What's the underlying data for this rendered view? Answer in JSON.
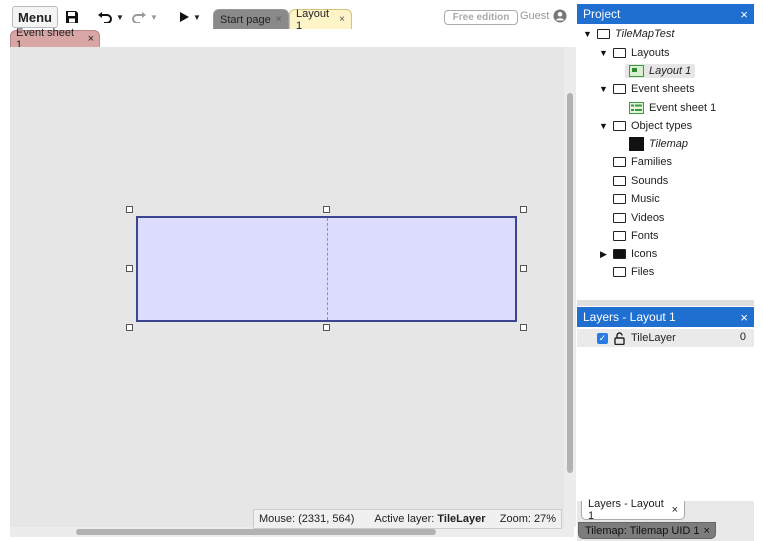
{
  "toolbar": {
    "menu_label": "Menu",
    "tabs": [
      {
        "label": "Start page",
        "close": "×"
      },
      {
        "label": "Layout 1",
        "close": "×"
      }
    ],
    "free_edition": "Free edition",
    "guest": "Guest"
  },
  "subtab": {
    "label": "Event sheet 1",
    "close": "×"
  },
  "status": {
    "mouse": "Mouse: (2331, 564)",
    "active_layer_label": "Active layer:",
    "active_layer_value": "TileLayer",
    "zoom": "Zoom: 27%"
  },
  "project": {
    "title": "Project",
    "close": "×",
    "root": "TileMapTest",
    "layouts": "Layouts",
    "layout_item": "Layout 1",
    "event_sheets": "Event sheets",
    "event_sheet_item": "Event sheet 1",
    "object_types": "Object types",
    "object_item": "Tilemap",
    "families": "Families",
    "sounds": "Sounds",
    "music": "Music",
    "videos": "Videos",
    "fonts": "Fonts",
    "icons": "Icons",
    "files": "Files"
  },
  "layers": {
    "title": "Layers - Layout 1",
    "close": "×",
    "layer_name": "TileLayer",
    "layer_count": "0"
  },
  "bottom_tabs": {
    "layers_tab": "Layers - Layout 1",
    "layers_close": "×",
    "tilemap_tab": "Tilemap: Tilemap UID 1",
    "tilemap_close": "×"
  },
  "colors": {
    "accent": "#1e6fd0",
    "tilemap_fill": "#dcdcfc",
    "tilemap_border": "#3d4490",
    "layout_tab": "#fff3c8",
    "event_tab": "#d9a6a6"
  }
}
